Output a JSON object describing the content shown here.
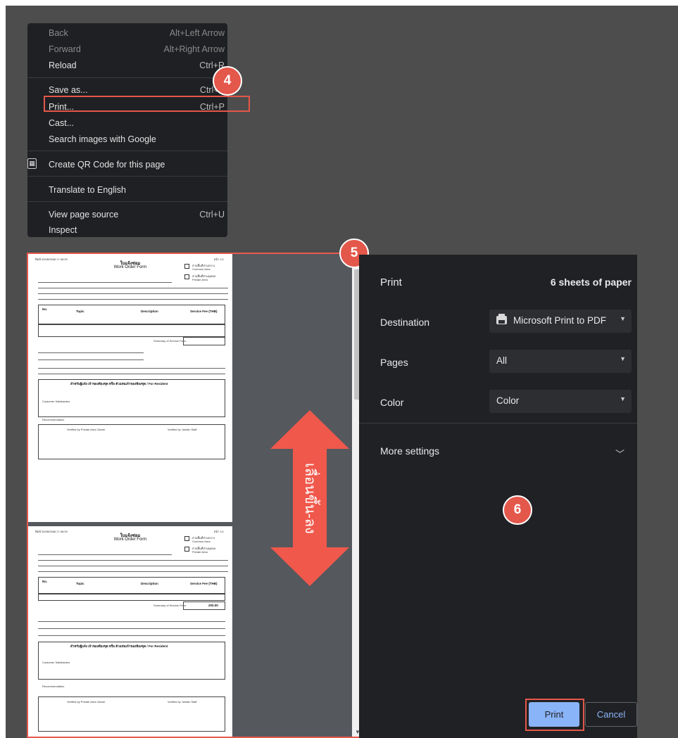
{
  "context_menu": {
    "items": [
      {
        "label": "Back",
        "shortcut": "Alt+Left Arrow"
      },
      {
        "label": "Forward",
        "shortcut": "Alt+Right Arrow"
      },
      {
        "label": "Reload",
        "shortcut": "Ctrl+R"
      },
      {
        "label": "Save as...",
        "shortcut": "Ctrl+S"
      },
      {
        "label": "Print...",
        "shortcut": "Ctrl+P"
      },
      {
        "label": "Cast..."
      },
      {
        "label": "Search images with Google"
      },
      {
        "label": "Create QR Code for this page"
      },
      {
        "label": "Translate to English"
      },
      {
        "label": "View page source",
        "shortcut": "Ctrl+U"
      },
      {
        "label": "Inspect"
      }
    ]
  },
  "badges": {
    "step4": "4",
    "step5": "5",
    "step6": "6"
  },
  "preview": {
    "scroll_hint": "เลื่อนขึ้น-ลง",
    "page": {
      "date": "พิมพ์ 25/08/2568 17:48:39",
      "page_no": "หน้า 1/1",
      "title_th": "ใบแจ้งซ่อม",
      "title_en": "Work Order Form",
      "chk_common": "ส่วนพื้นที่ส่วนกลาง",
      "chk_common_en": "Common Area",
      "chk_private": "ส่วนพื้นที่ส่วนบุคคล",
      "chk_private_en": "Private Area",
      "col_no": "No.",
      "col_topic": "Topic",
      "col_desc": "Description",
      "col_fee": "Service Fee (THB)",
      "summary": "Summary of Service Fees",
      "for_resident": "สำหรับผู้แจ้ง เจ้าของห้องชุด หรือ ตัวแทนเจ้าของห้องชุด / For Resident",
      "satisfaction": "Customer Satisfaction",
      "recommendation": "Recommendation",
      "verified_owner": "Verified by Private Area Owner",
      "verified_staff": "Verified by Juristic Staff"
    },
    "page2": {
      "fee_value": "200.00"
    }
  },
  "settings": {
    "title": "Print",
    "sheets": "6 sheets of paper",
    "destination_label": "Destination",
    "destination_value": "Microsoft Print to PDF",
    "pages_label": "Pages",
    "pages_value": "All",
    "color_label": "Color",
    "color_value": "Color",
    "more_settings": "More settings",
    "print_button": "Print",
    "cancel_button": "Cancel"
  },
  "colors": {
    "accent": "#8ab4f8",
    "highlight": "#e5574a",
    "panel_bg": "#202124"
  }
}
